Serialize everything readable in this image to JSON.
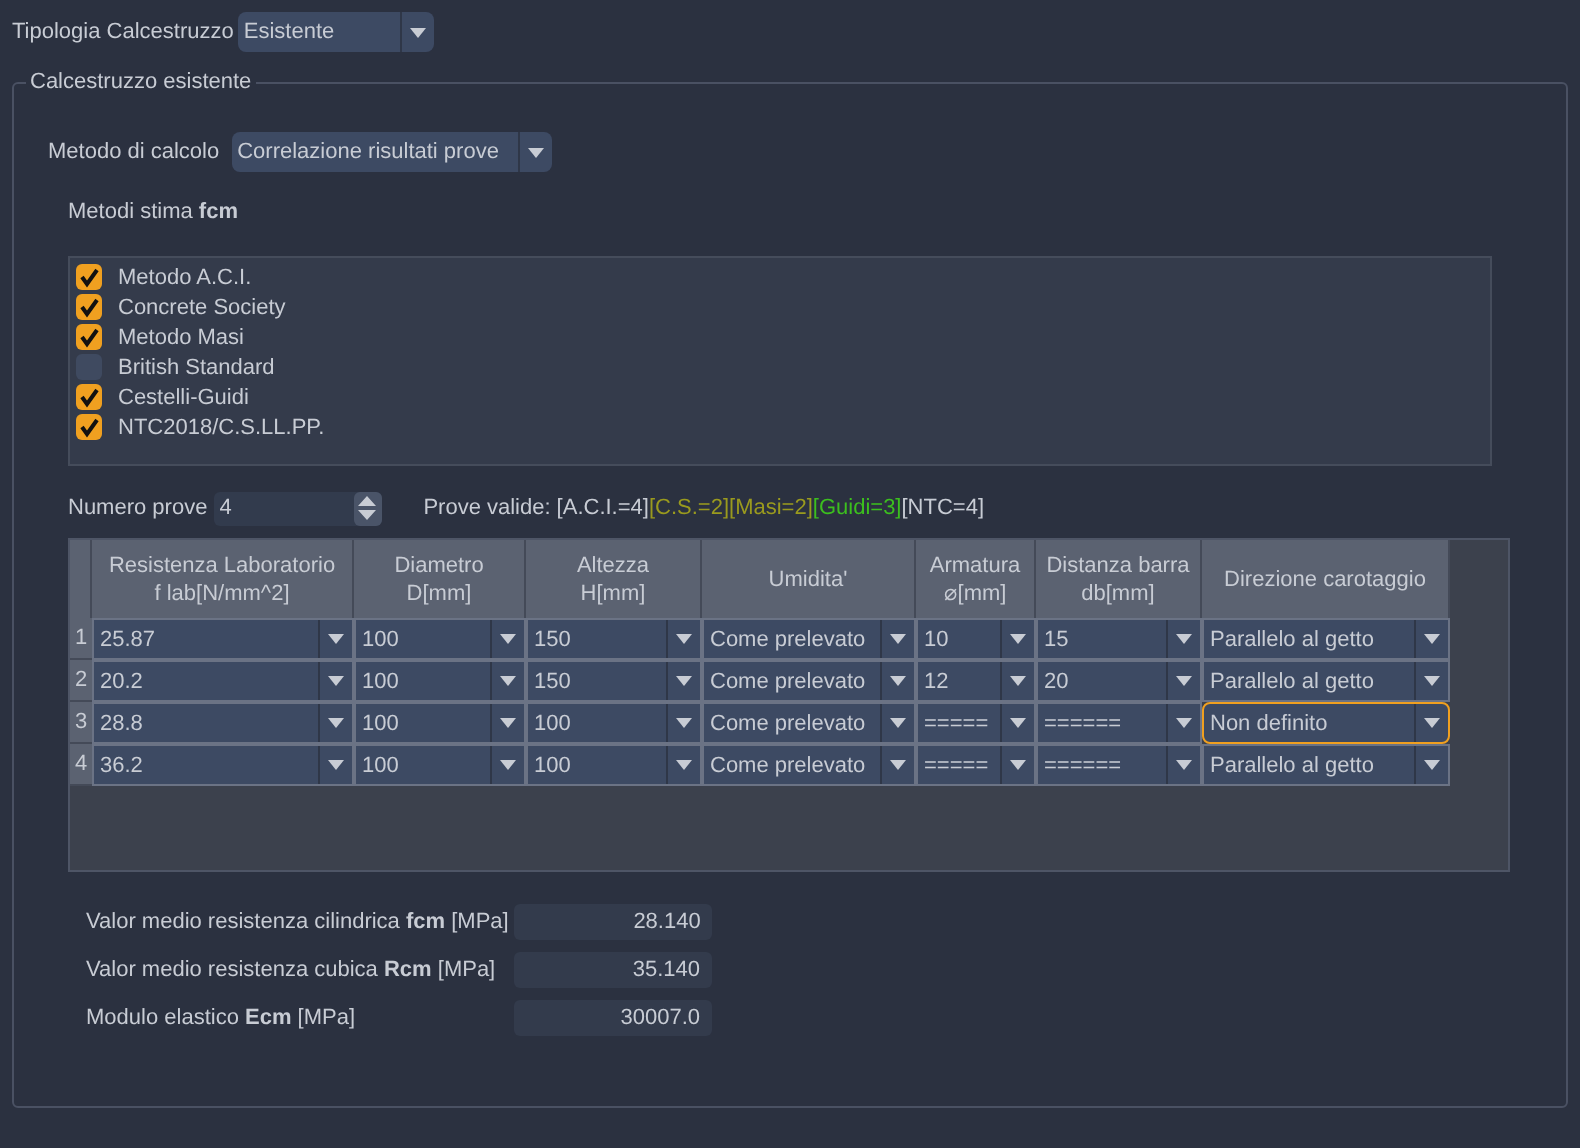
{
  "tipologia": {
    "label": "Tipologia Calcestruzzo",
    "value": "Esistente"
  },
  "group": {
    "title": "Calcestruzzo esistente",
    "metodo": {
      "label": "Metodo di calcolo",
      "value": "Correlazione risultati prove"
    },
    "metodi_stima": {
      "label": "Metodi stima **fcm**",
      "items": [
        {
          "label": "Metodo A.C.I.",
          "checked": true
        },
        {
          "label": "Concrete Society",
          "checked": true
        },
        {
          "label": "Metodo Masi",
          "checked": true
        },
        {
          "label": "British Standard",
          "checked": false
        },
        {
          "label": "Cestelli-Guidi",
          "checked": true
        },
        {
          "label": "NTC2018/C.S.LL.PP.",
          "checked": true
        }
      ]
    },
    "numero_prove": {
      "label": "Numero prove",
      "value": "4"
    },
    "prove_valide": {
      "label": "Prove valide:",
      "items": [
        {
          "label": "[A.C.I.=4]",
          "color": "#c8ccd4"
        },
        {
          "label": "[C.S.=2]",
          "color": "#9a9a1e"
        },
        {
          "label": "[Masi=2]",
          "color": "#9a9a1e"
        },
        {
          "label": "[Guidi=3]",
          "color": "#3cbf1e"
        },
        {
          "label": "[NTC=4]",
          "color": "#c8ccd4"
        }
      ]
    },
    "table": {
      "columns": [
        "Resistenza Laboratorio\nf lab[N/mm^2]",
        "Diametro\nD[mm]",
        "Altezza\nH[mm]",
        "Umidita'",
        "Armatura\n⌀[mm]",
        "Distanza barra\ndb[mm]",
        "Direzione carotaggio"
      ],
      "rows": [
        {
          "number": "1",
          "cells": [
            {
              "text": "25.87",
              "focused": false
            },
            {
              "text": "100",
              "focused": false
            },
            {
              "text": "150",
              "focused": false
            },
            {
              "text": "Come prelevato",
              "focused": false
            },
            {
              "text": "10",
              "focused": false
            },
            {
              "text": "15",
              "focused": false
            },
            {
              "text": "Parallelo al getto",
              "focused": false
            }
          ]
        },
        {
          "number": "2",
          "cells": [
            {
              "text": "20.2",
              "focused": false
            },
            {
              "text": "100",
              "focused": false
            },
            {
              "text": "150",
              "focused": false
            },
            {
              "text": "Come prelevato",
              "focused": false
            },
            {
              "text": "12",
              "focused": false
            },
            {
              "text": "20",
              "focused": false
            },
            {
              "text": "Parallelo al getto",
              "focused": false
            }
          ]
        },
        {
          "number": "3",
          "cells": [
            {
              "text": "28.8",
              "focused": false
            },
            {
              "text": "100",
              "focused": false
            },
            {
              "text": "100",
              "focused": false
            },
            {
              "text": "Come prelevato",
              "focused": false
            },
            {
              "text": "=====",
              "focused": false
            },
            {
              "text": "======",
              "focused": false
            },
            {
              "text": "Non definito",
              "focused": true
            }
          ]
        },
        {
          "number": "4",
          "cells": [
            {
              "text": "36.2",
              "focused": false
            },
            {
              "text": "100",
              "focused": false
            },
            {
              "text": "100",
              "focused": false
            },
            {
              "text": "Come prelevato",
              "focused": false
            },
            {
              "text": "=====",
              "focused": false
            },
            {
              "text": "======",
              "focused": false
            },
            {
              "text": "Parallelo al getto",
              "focused": false
            }
          ]
        }
      ]
    },
    "results": [
      {
        "label": "Valor medio resistenza cilindrica **fcm** [MPa]",
        "value": "28.140"
      },
      {
        "label": "Valor medio resistenza cubica **Rcm** [MPa]",
        "value": "35.140"
      },
      {
        "label": "Modulo elastico **Ecm** [MPa]",
        "value": "30007.0"
      }
    ]
  }
}
